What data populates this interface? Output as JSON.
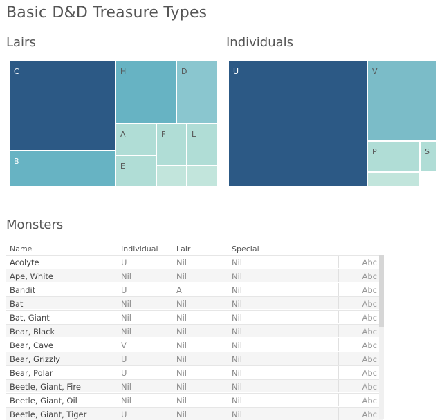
{
  "title": "Basic D&D Treasure Types",
  "lairs": {
    "heading": "Lairs",
    "tiles": [
      {
        "label": "C",
        "color": "#2c5985",
        "light": true
      },
      {
        "label": "B",
        "color": "#67b3c3",
        "light": true
      },
      {
        "label": "H",
        "color": "#67b3c3",
        "light": false
      },
      {
        "label": "D",
        "color": "#8ac6cf",
        "light": false
      },
      {
        "label": "A",
        "color": "#b0ddd6",
        "light": false
      },
      {
        "label": "E",
        "color": "#b0ddd6",
        "light": false
      },
      {
        "label": "F",
        "color": "#b0ddd6",
        "light": false
      },
      {
        "label": "L",
        "color": "#b0ddd6",
        "light": false
      },
      {
        "label": "",
        "color": "#c2e5dc",
        "light": false
      },
      {
        "label": "",
        "color": "#c2e5dc",
        "light": false
      }
    ]
  },
  "individuals": {
    "heading": "Individuals",
    "tiles": [
      {
        "label": "U",
        "color": "#2c5985",
        "light": true
      },
      {
        "label": "V",
        "color": "#7bbcc8",
        "light": false
      },
      {
        "label": "P",
        "color": "#b0ddd6",
        "light": false
      },
      {
        "label": "S",
        "color": "#b0ddd6",
        "light": false
      },
      {
        "label": "",
        "color": "#c2e5dc",
        "light": false
      }
    ]
  },
  "monsters": {
    "heading": "Monsters",
    "columns": [
      "Name",
      "Individual",
      "Lair",
      "Special"
    ],
    "rows": [
      {
        "name": "Acolyte",
        "individual": "U",
        "lair": "Nil",
        "special": "Nil",
        "abc": "Abc"
      },
      {
        "name": "Ape, White",
        "individual": "Nil",
        "lair": "Nil",
        "special": "Nil",
        "abc": "Abc"
      },
      {
        "name": "Bandit",
        "individual": "U",
        "lair": "A",
        "special": "Nil",
        "abc": "Abc"
      },
      {
        "name": "Bat",
        "individual": "Nil",
        "lair": "Nil",
        "special": "Nil",
        "abc": "Abc"
      },
      {
        "name": "Bat, Giant",
        "individual": "Nil",
        "lair": "Nil",
        "special": "Nil",
        "abc": "Abc"
      },
      {
        "name": "Bear, Black",
        "individual": "Nil",
        "lair": "Nil",
        "special": "Nil",
        "abc": "Abc"
      },
      {
        "name": "Bear, Cave",
        "individual": "V",
        "lair": "Nil",
        "special": "Nil",
        "abc": "Abc"
      },
      {
        "name": "Bear, Grizzly",
        "individual": "U",
        "lair": "Nil",
        "special": "Nil",
        "abc": "Abc"
      },
      {
        "name": "Bear, Polar",
        "individual": "U",
        "lair": "Nil",
        "special": "Nil",
        "abc": "Abc"
      },
      {
        "name": "Beetle, Giant, Fire",
        "individual": "Nil",
        "lair": "Nil",
        "special": "Nil",
        "abc": "Abc"
      },
      {
        "name": "Beetle, Giant, Oil",
        "individual": "Nil",
        "lair": "Nil",
        "special": "Nil",
        "abc": "Abc"
      },
      {
        "name": "Beetle, Giant, Tiger",
        "individual": "U",
        "lair": "Nil",
        "special": "Nil",
        "abc": "Abc"
      }
    ]
  }
}
